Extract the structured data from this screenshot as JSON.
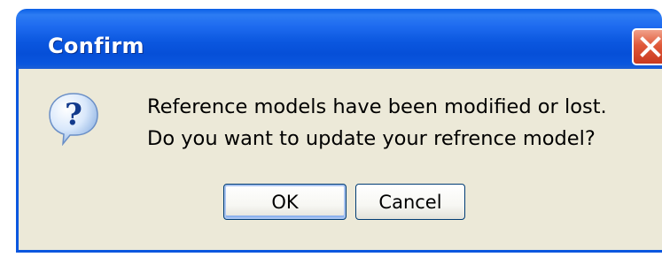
{
  "dialog": {
    "title": "Confirm",
    "close_icon": "close-icon",
    "icon": "question-icon",
    "message_line1": "Reference models have been modified or lost.",
    "message_line2": "Do you want to update your refrence model?",
    "buttons": {
      "ok_label": "OK",
      "cancel_label": "Cancel"
    }
  },
  "colors": {
    "titlebar_blue": "#0b57df",
    "client_bg": "#ece9d8",
    "close_red": "#d9502f",
    "button_border": "#003c74"
  }
}
